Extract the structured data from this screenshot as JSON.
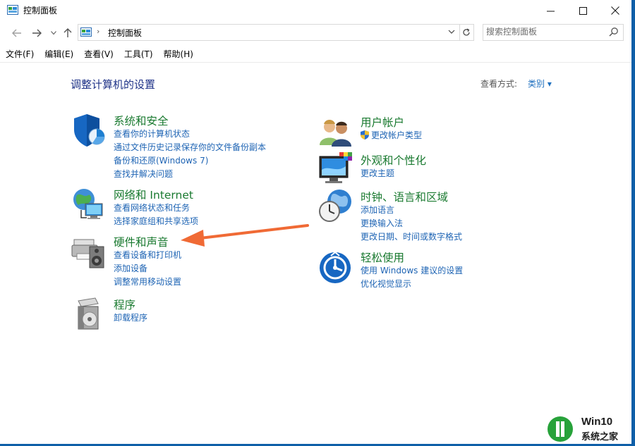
{
  "window": {
    "title": "控制面板"
  },
  "address": {
    "crumb": "控制面板"
  },
  "search": {
    "placeholder": "搜索控制面板"
  },
  "menu": [
    "文件(F)",
    "编辑(E)",
    "查看(V)",
    "工具(T)",
    "帮助(H)"
  ],
  "content": {
    "title": "调整计算机的设置",
    "view_by_label": "查看方式:",
    "view_by_value": "类别 ▾"
  },
  "categories": {
    "system": {
      "title": "系统和安全",
      "links": [
        "查看你的计算机状态",
        "通过文件历史记录保存你的文件备份副本",
        "备份和还原(Windows 7)",
        "查找并解决问题"
      ]
    },
    "network": {
      "title": "网络和 Internet",
      "links": [
        "查看网络状态和任务",
        "选择家庭组和共享选项"
      ]
    },
    "hardware": {
      "title": "硬件和声音",
      "links": [
        "查看设备和打印机",
        "添加设备",
        "调整常用移动设置"
      ]
    },
    "programs": {
      "title": "程序",
      "links": [
        "卸载程序"
      ]
    },
    "user": {
      "title": "用户帐户",
      "links": [
        "更改帐户类型"
      ]
    },
    "appearance": {
      "title": "外观和个性化",
      "links": [
        "更改主题"
      ]
    },
    "clock": {
      "title": "时钟、语言和区域",
      "links": [
        "添加语言",
        "更换输入法",
        "更改日期、时间或数字格式"
      ]
    },
    "ease": {
      "title": "轻松使用",
      "links": [
        "使用 Windows 建议的设置",
        "优化视觉显示"
      ]
    }
  },
  "watermark": {
    "brand": "Win10",
    "site": "系统之家"
  },
  "colors": {
    "heading": "#1a7a30",
    "link": "#1e64b4",
    "title": "#1e3287",
    "arrow": "#f06a35"
  }
}
